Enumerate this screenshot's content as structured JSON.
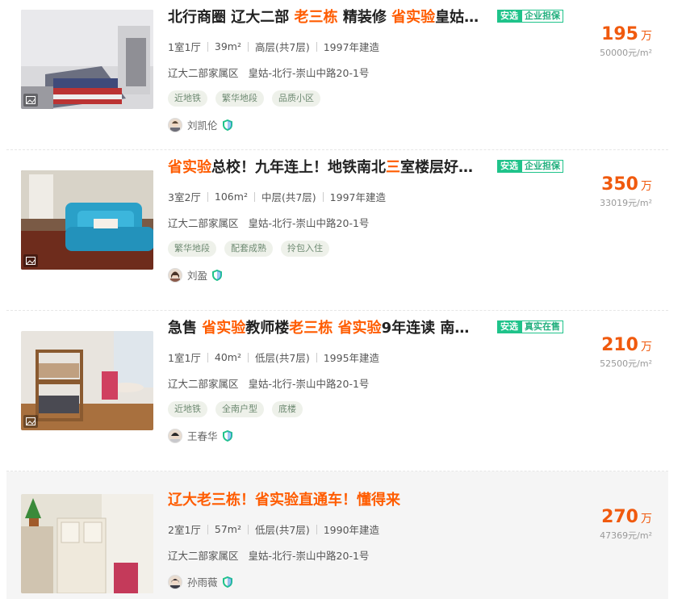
{
  "listings": [
    {
      "title_segments": [
        {
          "text": "北行商圈 辽大二部 ",
          "hi": false
        },
        {
          "text": "老三栋",
          "hi": true
        },
        {
          "text": " 精装修 ",
          "hi": false
        },
        {
          "text": "省实验",
          "hi": true
        },
        {
          "text": "皇姑",
          "hi": false
        },
        {
          "text": "…",
          "hi": false
        }
      ],
      "badge_primary": "安选",
      "badge_secondary": "企业担保",
      "layout": "1室1厅",
      "area": "39m²",
      "floor": "高层(共7层)",
      "built": "1997年建造",
      "community": "辽大二部家属区",
      "address": "皇姑-北行-崇山中路20-1号",
      "tags": [
        "近地铁",
        "繁华地段",
        "品质小区"
      ],
      "agent": "刘凯伦",
      "price": "195",
      "price_unit": "万",
      "unit_price": "50000元/m²",
      "photo_icon": "image-icon",
      "verified_icon": "shield-check-icon"
    },
    {
      "title_segments": [
        {
          "text": "省实验",
          "hi": true
        },
        {
          "text": "总校！九年连上！地铁南北",
          "hi": false
        },
        {
          "text": "三",
          "hi": true
        },
        {
          "text": "室楼层好",
          "hi": false
        },
        {
          "text": "…",
          "hi": false
        }
      ],
      "badge_primary": "安选",
      "badge_secondary": "企业担保",
      "layout": "3室2厅",
      "area": "106m²",
      "floor": "中层(共7层)",
      "built": "1997年建造",
      "community": "辽大二部家属区",
      "address": "皇姑-北行-崇山中路20-1号",
      "tags": [
        "繁华地段",
        "配套成熟",
        "拎包入住"
      ],
      "agent": "刘盈",
      "price": "350",
      "price_unit": "万",
      "unit_price": "33019元/m²"
    },
    {
      "title_segments": [
        {
          "text": "急售 ",
          "hi": false
        },
        {
          "text": "省实验",
          "hi": true
        },
        {
          "text": "教师楼",
          "hi": false
        },
        {
          "text": "老三栋",
          "hi": true
        },
        {
          "text": " ",
          "hi": false
        },
        {
          "text": "省实验",
          "hi": true
        },
        {
          "text": "9年连读 南",
          "hi": false
        },
        {
          "text": "…",
          "hi": false
        }
      ],
      "badge_primary": "安选",
      "badge_secondary": "真实在售",
      "layout": "1室1厅",
      "area": "40m²",
      "floor": "低层(共7层)",
      "built": "1995年建造",
      "community": "辽大二部家属区",
      "address": "皇姑-北行-崇山中路20-1号",
      "tags": [
        "近地铁",
        "全南户型",
        "底楼"
      ],
      "agent": "王春华",
      "price": "210",
      "price_unit": "万",
      "unit_price": "52500元/m²"
    },
    {
      "title_segments": [
        {
          "text": "辽大老三栋！省实验直通车！懂得来",
          "hi": true
        }
      ],
      "badge_primary": "",
      "badge_secondary": "",
      "layout": "2室1厅",
      "area": "57m²",
      "floor": "低层(共7层)",
      "built": "1990年建造",
      "community": "辽大二部家属区",
      "address": "皇姑-北行-崇山中路20-1号",
      "tags": [],
      "agent": "孙雨薇",
      "price": "270",
      "price_unit": "万",
      "unit_price": "47369元/m²"
    }
  ],
  "colors": {
    "highlight": "#ff5c00",
    "price": "#f05a0e",
    "badge_green": "#1fc38a",
    "shield_green": "#1fc38a",
    "shield_blue": "#3a8ee6"
  }
}
